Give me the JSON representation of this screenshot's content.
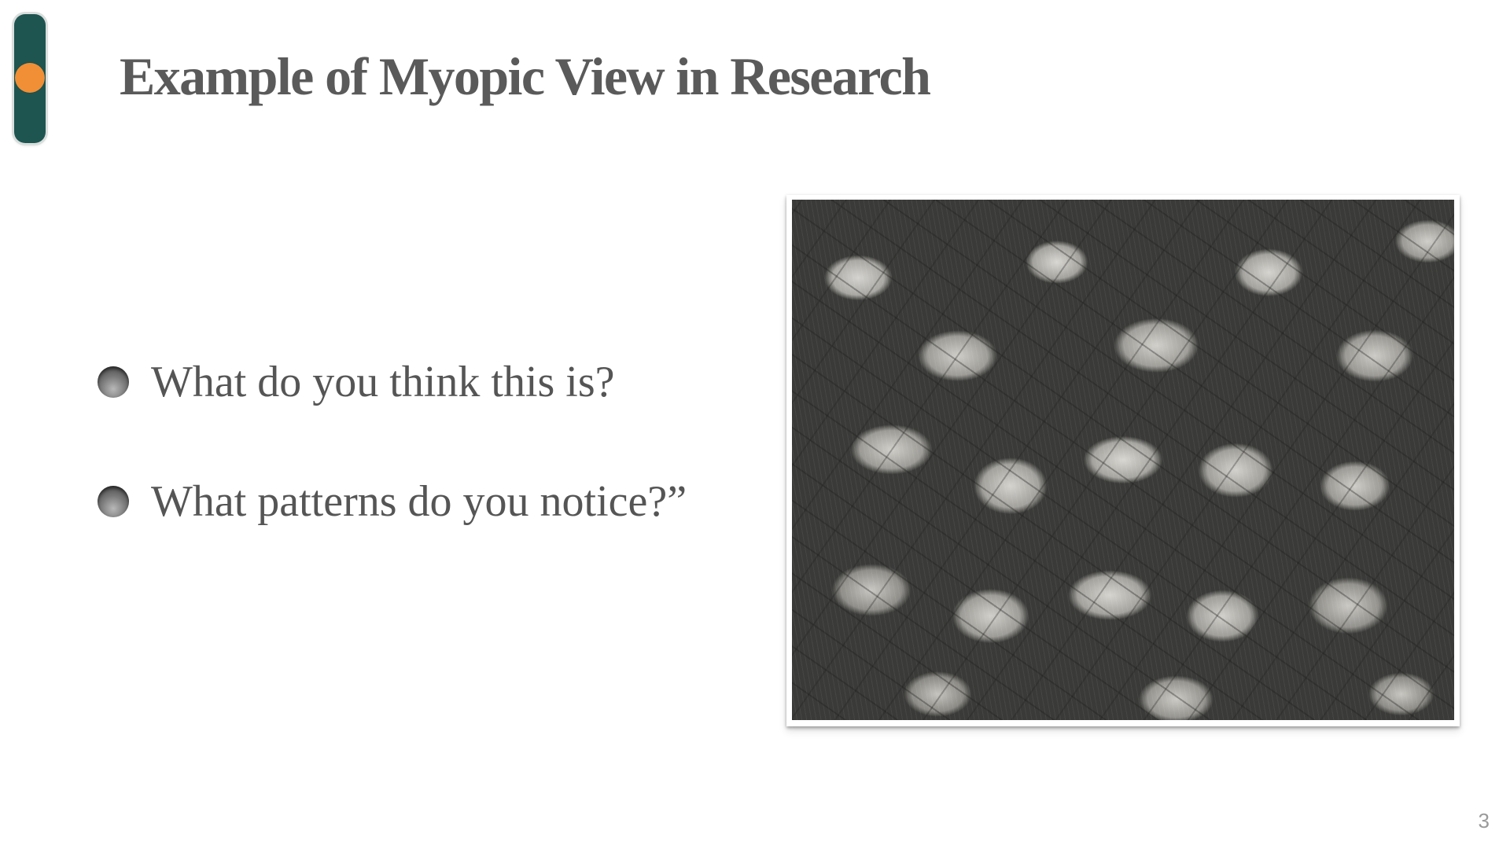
{
  "slide": {
    "title": "Example of Myopic View in Research",
    "bullets": [
      {
        "text": "What do you think this is?"
      },
      {
        "text": "What patterns do you notice?”"
      }
    ],
    "image": {
      "icon": "texture-photo",
      "description_hidden": ""
    },
    "page_number": "3"
  },
  "colors": {
    "title_text": "#5a5a5a",
    "body_text": "#555555",
    "side_tab": "#1f5551",
    "side_dot": "#f08f36",
    "page_number": "#9a9a9a"
  }
}
